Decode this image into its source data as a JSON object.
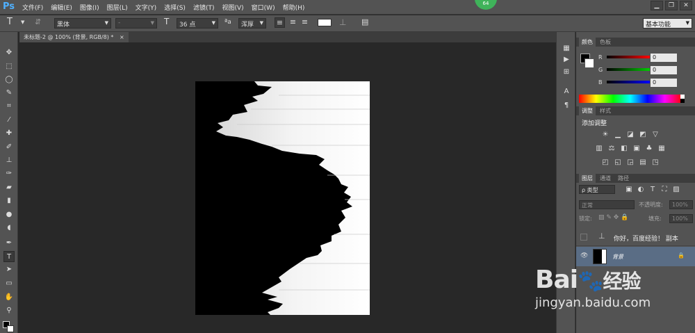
{
  "app": {
    "logo": "Ps"
  },
  "menu": [
    "文件(F)",
    "编辑(E)",
    "图像(I)",
    "图层(L)",
    "文字(Y)",
    "选择(S)",
    "滤镜(T)",
    "视图(V)",
    "窗口(W)",
    "帮助(H)"
  ],
  "badge": "64",
  "window_controls": [
    "▁",
    "❐",
    "✕"
  ],
  "options": {
    "font_family": "黑体",
    "font_style": "-",
    "size_icon": "T",
    "size": "36 点",
    "aa_label": "ªa",
    "antialias": "浑厚",
    "workspace": "基本功能"
  },
  "document_tab": {
    "title": "未标题-2 @ 100% (背景, RGB/8) *",
    "close": "×"
  },
  "panels": {
    "color": {
      "tabs": [
        "颜色",
        "色板"
      ],
      "channels": [
        {
          "name": "R",
          "value": "0"
        },
        {
          "name": "G",
          "value": "0"
        },
        {
          "name": "B",
          "value": "0"
        }
      ]
    },
    "adjustments": {
      "tabs": [
        "调整",
        "样式"
      ],
      "title": "添加调整"
    },
    "layers": {
      "tabs": [
        "图层",
        "通道",
        "路径"
      ],
      "filter": "ρ 类型",
      "blend_mode": "正常",
      "opacity_label": "不透明度:",
      "opacity": "100%",
      "lock_label": "锁定:",
      "fill_label": "填充:",
      "fill": "100%",
      "items": [
        {
          "name": "你好，百度经验！ 副本"
        },
        {
          "name": "背景"
        }
      ]
    }
  },
  "watermark": {
    "brand": "Bai",
    "brand_cn": "经验",
    "url": "jingyan.baidu.com"
  },
  "colors": {
    "accent": "#4fb0ff",
    "badge": "#3fb35a",
    "selected_layer": "#5a6d85"
  }
}
